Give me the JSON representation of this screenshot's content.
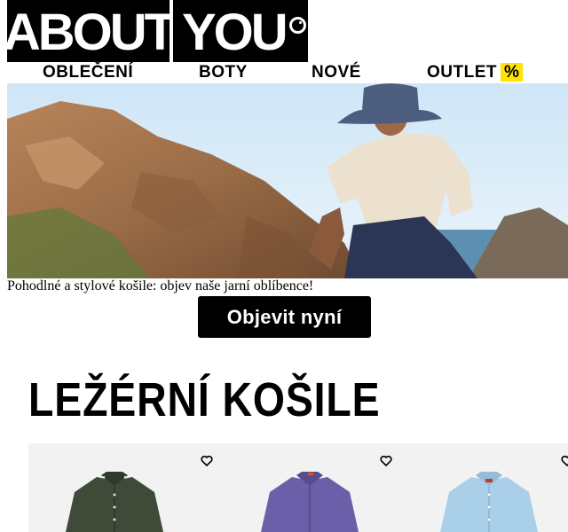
{
  "brand": {
    "logo_left": "ABOUT",
    "logo_right": "YOU"
  },
  "nav": [
    {
      "label": "OBLEČENÍ"
    },
    {
      "label": "BOTY"
    },
    {
      "label": "NOVÉ"
    },
    {
      "label": "OUTLET",
      "badge": "%"
    }
  ],
  "hero": {
    "caption": "Pohodlné a stylové košile: objev naše jarní oblíbence!",
    "cta_label": "Objevit nyní"
  },
  "section": {
    "title": "LEŽÉRNÍ KOŠILE"
  },
  "products": [
    {
      "color": "#3f4b38",
      "icon": "heart-outline-icon"
    },
    {
      "color": "#6a5fa8",
      "icon": "heart-outline-icon"
    },
    {
      "color": "#a9cfe9",
      "icon": "heart-outline-icon"
    }
  ],
  "colors": {
    "accent": "#ffe400",
    "button": "#000000",
    "product_bg": "#f2f2f2"
  }
}
